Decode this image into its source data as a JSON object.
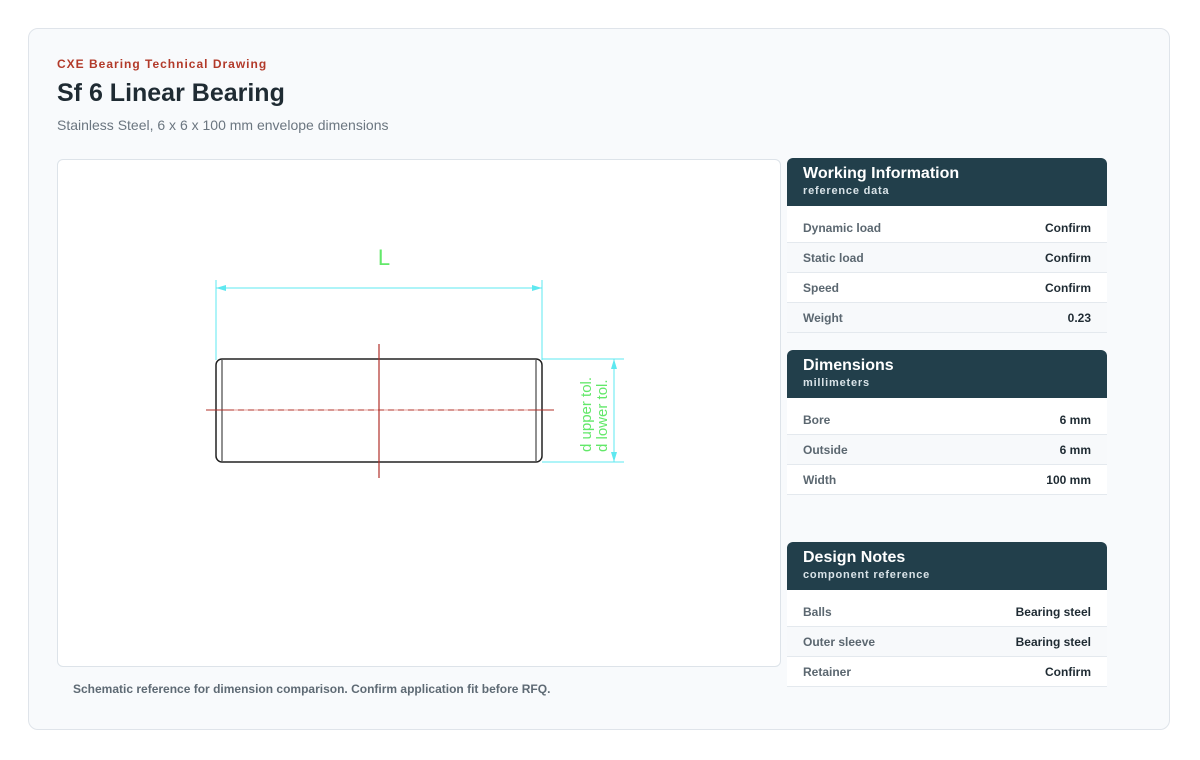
{
  "header": {
    "eyebrow": "CXE Bearing Technical Drawing",
    "title": "Sf 6 Linear Bearing",
    "subtitle": "Stainless Steel, 6 x 6 x 100 mm envelope dimensions"
  },
  "drawing": {
    "length_label": "L",
    "upper_tol_label": "d upper tol.",
    "lower_tol_label": "d lower tol.",
    "caption": "Schematic reference for dimension comparison. Confirm application fit before RFQ.",
    "colors": {
      "outline": "#222222",
      "centerline": "#b0302a",
      "dimension": "#5ee8f0",
      "label": "#63e86a"
    }
  },
  "panels": [
    {
      "title": "Working Information",
      "subtitle": "reference data",
      "rows": [
        {
          "label": "Dynamic load",
          "value": "Confirm"
        },
        {
          "label": "Static load",
          "value": "Confirm"
        },
        {
          "label": "Speed",
          "value": "Confirm"
        },
        {
          "label": "Weight",
          "value": "0.23"
        }
      ]
    },
    {
      "title": "Dimensions",
      "subtitle": "millimeters",
      "rows": [
        {
          "label": "Bore",
          "value": "6 mm"
        },
        {
          "label": "Outside",
          "value": "6 mm"
        },
        {
          "label": "Width",
          "value": "100 mm"
        }
      ]
    },
    {
      "title": "Design Notes",
      "subtitle": "component reference",
      "rows": [
        {
          "label": "Balls",
          "value": "Bearing steel"
        },
        {
          "label": "Outer sleeve",
          "value": "Bearing steel"
        },
        {
          "label": "Retainer",
          "value": "Confirm"
        }
      ]
    }
  ],
  "theme": {
    "accent": "#b23a2a",
    "panel_header": "#223f4b"
  }
}
